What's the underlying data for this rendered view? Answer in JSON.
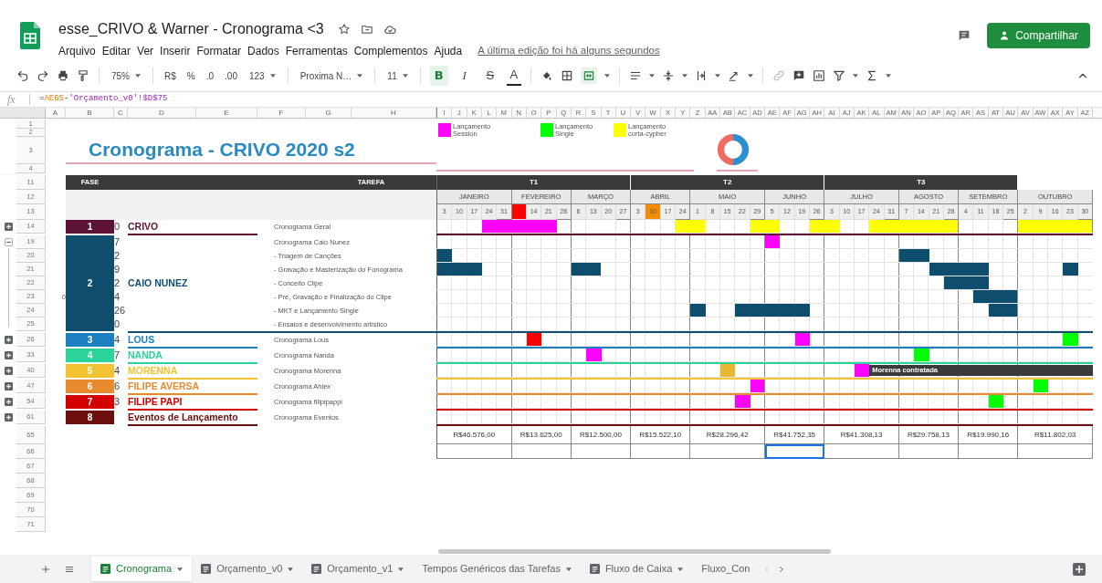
{
  "header": {
    "title": "esse_CRIVO & Warner - Cronograma <3",
    "menus": [
      "Arquivo",
      "Editar",
      "Ver",
      "Inserir",
      "Formatar",
      "Dados",
      "Ferramentas",
      "Complementos",
      "Ajuda"
    ],
    "last_edit": "A última edição foi há alguns segundos",
    "share_button": "Compartilhar"
  },
  "toolbar": {
    "merge_active": true,
    "items": [
      {
        "kind": "dropdown",
        "text": "75%"
      },
      {
        "kind": "plain",
        "text": "R$"
      },
      {
        "kind": "plain",
        "text": "%"
      },
      {
        "kind": "plain",
        "text": ".0"
      },
      {
        "kind": "plain",
        "text": ".00"
      },
      {
        "kind": "dropdown",
        "text": "123"
      },
      {
        "kind": "dropdown",
        "text": "Proxima N…"
      },
      {
        "kind": "dropdown",
        "text": "11"
      },
      {
        "kind": "bold",
        "text": "B",
        "selected": true
      },
      {
        "kind": "italic",
        "text": "I",
        "selected": false
      },
      {
        "kind": "strike",
        "text": "S",
        "selected": false
      },
      {
        "kind": "color",
        "text": "A"
      }
    ]
  },
  "formula_bar": {
    "label": "fx",
    "parts": [
      {
        "kind": "operator",
        "text": "="
      },
      {
        "kind": "reference",
        "text": "AE65"
      },
      {
        "kind": "operator",
        "text": "-"
      },
      {
        "kind": "sheet_reference",
        "text": "'Orçamento_v0'!$D$75"
      }
    ]
  },
  "columns_left": [
    "A",
    "B",
    "C",
    "D",
    "E",
    "F",
    "G",
    "H"
  ],
  "columns_grid": [
    "I",
    "J",
    "K",
    "L",
    "M",
    "N",
    "O",
    "P",
    "Q",
    "R",
    "S",
    "T",
    "U",
    "V",
    "W",
    "X",
    "Y",
    "Z",
    "AA",
    "AB",
    "AC",
    "AD",
    "AE",
    "AF",
    "AG",
    "AH",
    "AI",
    "AJ",
    "AK",
    "AL",
    "AM",
    "AN",
    "AO",
    "AP",
    "AQ",
    "AR",
    "AS",
    "AT",
    "AU",
    "AV",
    "AW",
    "AX",
    "AY",
    "AZ"
  ],
  "top_rows": [
    "1",
    "2",
    "3",
    "4"
  ],
  "sheet_title": "Cronograma - CRIVO 2020 s2",
  "legend": [
    {
      "label": "Lançamento Session",
      "color": "#ff00ff"
    },
    {
      "label": "Lançamento Single",
      "color": "#00ff00"
    },
    {
      "label": "Lançamento curta-cypher",
      "color": "#ffff00"
    }
  ],
  "header_rows": [
    "11",
    "12",
    "13"
  ],
  "fase_header": "FASE",
  "tarefa_header": "TAREFA",
  "timeline": {
    "quarters": [
      {
        "label": "T1",
        "months": [
          {
            "name": "JANEIRO",
            "weeks": [
              {
                "label": "3"
              },
              {
                "label": "10"
              },
              {
                "label": "17"
              },
              {
                "label": "24"
              },
              {
                "label": "31"
              }
            ]
          },
          {
            "name": "FEVEREIRO",
            "weeks": [
              {
                "color": "#ff0000"
              },
              {
                "label": "14"
              },
              {
                "label": "21"
              },
              {
                "label": "28"
              }
            ]
          },
          {
            "name": "MARÇO",
            "weeks": [
              {
                "label": "6"
              },
              {
                "label": "13"
              },
              {
                "label": "20"
              },
              {
                "label": "27"
              }
            ]
          }
        ]
      },
      {
        "label": "T2",
        "months": [
          {
            "name": "ABRIL",
            "weeks": [
              {
                "label": "3"
              },
              {
                "label": "10",
                "color": "#f28c00"
              },
              {
                "label": "17"
              },
              {
                "label": "24"
              }
            ]
          },
          {
            "name": "MAIO",
            "weeks": [
              {
                "label": "1"
              },
              {
                "label": "8"
              },
              {
                "label": "15"
              },
              {
                "label": "22"
              },
              {
                "label": "29"
              }
            ]
          },
          {
            "name": "JUNHO",
            "weeks": [
              {
                "label": "5"
              },
              {
                "label": "12"
              },
              {
                "label": "19"
              },
              {
                "label": "26"
              }
            ]
          }
        ]
      },
      {
        "label": "T3",
        "months": [
          {
            "name": "JULHO",
            "weeks": [
              {
                "label": "3"
              },
              {
                "label": "10"
              },
              {
                "label": "17"
              },
              {
                "label": "24"
              },
              {
                "label": "31"
              }
            ]
          },
          {
            "name": "AGOSTO",
            "weeks": [
              {
                "label": "7"
              },
              {
                "label": "14"
              },
              {
                "label": "21"
              },
              {
                "label": "28"
              }
            ]
          },
          {
            "name": "SETEMBRO",
            "weeks": [
              {
                "label": "4"
              },
              {
                "label": "11"
              },
              {
                "label": "18"
              },
              {
                "label": "25"
              }
            ]
          }
        ]
      },
      {
        "months": [
          {
            "name": "OUTUBRO",
            "weeks": [
              {
                "label": "2"
              },
              {
                "label": "9"
              },
              {
                "label": "16"
              },
              {
                "label": "23"
              },
              {
                "label": "30"
              }
            ]
          }
        ]
      }
    ]
  },
  "phases": [
    {
      "number": "1",
      "color": "#5c1234",
      "name": "CRIVO",
      "collapsed": true,
      "tasks": [
        {
          "row": "14",
          "count": "0",
          "task": "Cronograma Geral",
          "cells": [
            null,
            null,
            null,
            {
              "color": "#ff00ff"
            },
            {
              "color": "#ff00ff"
            },
            {
              "color": "#ff00ff"
            },
            {
              "color": "#ff00ff"
            },
            {
              "color": "#ff00ff"
            },
            null,
            null,
            null,
            null,
            null,
            null,
            null,
            null,
            {
              "color": "#ffff00"
            },
            {
              "color": "#ffff00"
            },
            null,
            null,
            null,
            {
              "color": "#ffff00"
            },
            {
              "color": "#ffff00"
            },
            null,
            null,
            {
              "color": "#ffff00"
            },
            {
              "color": "#ffff00"
            },
            null,
            null,
            {
              "color": "#ffff00"
            },
            {
              "color": "#ffff00"
            },
            {
              "color": "#ffff00"
            },
            {
              "color": "#ffff00"
            },
            {
              "color": "#ffff00"
            },
            {
              "color": "#ffff00"
            },
            null,
            null,
            null,
            null,
            {
              "color": "#ffff00"
            },
            {
              "color": "#ffff00"
            },
            {
              "color": "#ffff00"
            },
            {
              "color": "#ffff00"
            },
            {
              "color": "#ffff00"
            }
          ]
        }
      ]
    },
    {
      "number": "2",
      "color": "#0e4d6e",
      "name": "CAIO NUNEZ",
      "collapsed": false,
      "tasks": [
        {
          "row": "19",
          "count": "7",
          "task": "Cronograma Caio Nunez",
          "cells": [
            null,
            null,
            null,
            null,
            null,
            null,
            null,
            null,
            null,
            null,
            null,
            null,
            null,
            null,
            null,
            null,
            null,
            null,
            null,
            null,
            null,
            null,
            {
              "color": "#ff00ff"
            }
          ]
        },
        {
          "row": "20",
          "count": "2",
          "task": "- Triagem de Canções",
          "cells": [
            {
              "color": "#0e4d6e"
            },
            null,
            null,
            null,
            null,
            null,
            null,
            null,
            null,
            null,
            null,
            null,
            null,
            null,
            null,
            null,
            null,
            null,
            null,
            null,
            null,
            null,
            null,
            null,
            null,
            null,
            null,
            null,
            null,
            null,
            null,
            {
              "color": "#0e4d6e"
            },
            {
              "color": "#0e4d6e"
            }
          ]
        },
        {
          "row": "21",
          "count": "9",
          "task": "- Gravação e Masterização do Fonograma",
          "cells": [
            {
              "color": "#0e4d6e"
            },
            {
              "color": "#0e4d6e"
            },
            {
              "color": "#0e4d6e"
            },
            null,
            null,
            null,
            null,
            null,
            null,
            {
              "color": "#0e4d6e"
            },
            {
              "color": "#0e4d6e"
            },
            null,
            null,
            null,
            null,
            null,
            null,
            null,
            null,
            null,
            null,
            null,
            null,
            null,
            null,
            null,
            null,
            null,
            null,
            null,
            null,
            null,
            null,
            {
              "color": "#0e4d6e"
            },
            {
              "color": "#0e4d6e"
            },
            {
              "color": "#0e4d6e"
            },
            {
              "color": "#0e4d6e"
            },
            null,
            null,
            null,
            null,
            null,
            {
              "color": "#0e4d6e"
            }
          ]
        },
        {
          "row": "22",
          "count": "2",
          "task": "- Conceito Clipe",
          "cells": [
            null,
            null,
            null,
            null,
            null,
            null,
            null,
            null,
            null,
            null,
            null,
            null,
            null,
            null,
            null,
            null,
            null,
            null,
            null,
            null,
            null,
            null,
            null,
            null,
            null,
            null,
            null,
            null,
            null,
            null,
            null,
            null,
            null,
            null,
            {
              "color": "#0e4d6e"
            },
            {
              "color": "#0e4d6e"
            },
            {
              "color": "#0e4d6e"
            }
          ]
        },
        {
          "row": "23",
          "count": "4",
          "column_a": "0",
          "task": "- Pré, Gravação e Finalização do Clipe",
          "cells": [
            null,
            null,
            null,
            null,
            null,
            null,
            null,
            null,
            null,
            null,
            null,
            null,
            null,
            null,
            null,
            null,
            null,
            null,
            null,
            null,
            null,
            null,
            null,
            null,
            null,
            null,
            null,
            null,
            null,
            null,
            null,
            null,
            null,
            null,
            null,
            null,
            {
              "color": "#0e4d6e"
            },
            {
              "color": "#0e4d6e"
            },
            {
              "color": "#0e4d6e"
            }
          ]
        },
        {
          "row": "24",
          "count": "26",
          "task": "- MKT e Lançamento Single",
          "cells": [
            null,
            null,
            null,
            null,
            null,
            null,
            null,
            null,
            null,
            null,
            null,
            null,
            null,
            null,
            null,
            null,
            null,
            {
              "color": "#0e4d6e"
            },
            null,
            null,
            {
              "color": "#0e4d6e"
            },
            {
              "color": "#0e4d6e"
            },
            {
              "color": "#0e4d6e"
            },
            {
              "color": "#0e4d6e"
            },
            {
              "color": "#0e4d6e"
            },
            null,
            null,
            null,
            null,
            null,
            null,
            null,
            null,
            null,
            null,
            null,
            null,
            {
              "color": "#0e4d6e"
            },
            {
              "color": "#0e4d6e"
            }
          ]
        },
        {
          "row": "25",
          "count": "0",
          "task": "- Ensaios e desenvolvimento artístico"
        }
      ]
    },
    {
      "number": "3",
      "color": "#1b7fc0",
      "name": "LOUS",
      "collapsed": true,
      "tasks": [
        {
          "row": "26",
          "count": "4",
          "task": "Cronograma Lous",
          "cells": [
            null,
            null,
            null,
            null,
            null,
            null,
            {
              "color": "#ff0000"
            },
            null,
            null,
            null,
            null,
            null,
            null,
            null,
            null,
            null,
            null,
            null,
            null,
            null,
            null,
            null,
            null,
            null,
            {
              "color": "#ff00ff"
            },
            null,
            null,
            null,
            null,
            null,
            null,
            null,
            null,
            null,
            null,
            null,
            null,
            null,
            null,
            null,
            null,
            null,
            {
              "color": "#00ff00"
            }
          ]
        }
      ]
    },
    {
      "number": "4",
      "color": "#2bd39a",
      "name": "NANDA",
      "collapsed": true,
      "tasks": [
        {
          "row": "33",
          "count": "7",
          "task": "Cronograma Nanda",
          "cells": [
            null,
            null,
            null,
            null,
            null,
            null,
            null,
            null,
            null,
            null,
            {
              "color": "#ff00ff"
            },
            null,
            null,
            null,
            null,
            null,
            null,
            null,
            null,
            null,
            null,
            null,
            null,
            null,
            null,
            null,
            null,
            null,
            null,
            null,
            null,
            null,
            {
              "color": "#00ff00"
            }
          ]
        }
      ]
    },
    {
      "number": "5",
      "color": "#f2c230",
      "name": "MORENNA",
      "collapsed": true,
      "tasks": [
        {
          "row": "40",
          "count": "4",
          "task": "Cronograma Morenna",
          "note": "Morenna contratada",
          "cells": [
            null,
            null,
            null,
            null,
            null,
            null,
            null,
            null,
            null,
            null,
            null,
            null,
            null,
            null,
            null,
            null,
            null,
            null,
            null,
            {
              "color": "#e8b830"
            },
            null,
            null,
            null,
            null,
            null,
            null,
            null,
            null,
            {
              "color": "#ff00ff"
            }
          ]
        }
      ]
    },
    {
      "number": "6",
      "color": "#e88a2e",
      "name": "FILIPE AVERSA",
      "collapsed": true,
      "tasks": [
        {
          "row": "47",
          "count": "6",
          "task": "Cronograma Ahlex",
          "cells": [
            null,
            null,
            null,
            null,
            null,
            null,
            null,
            null,
            null,
            null,
            null,
            null,
            null,
            null,
            null,
            null,
            null,
            null,
            null,
            null,
            null,
            {
              "color": "#ff00ff"
            },
            null,
            null,
            null,
            null,
            null,
            null,
            null,
            null,
            null,
            null,
            null,
            null,
            null,
            null,
            null,
            null,
            null,
            null,
            {
              "color": "#00ff00"
            }
          ]
        }
      ]
    },
    {
      "number": "7",
      "color": "#d40000",
      "name": "FILIPE PAPI",
      "collapsed": true,
      "tasks": [
        {
          "row": "54",
          "count": "3",
          "task": "Cronograma filipipappi",
          "cells": [
            null,
            null,
            null,
            null,
            null,
            null,
            null,
            null,
            null,
            null,
            null,
            null,
            null,
            null,
            null,
            null,
            null,
            null,
            null,
            null,
            {
              "color": "#ff00ff"
            },
            null,
            null,
            null,
            null,
            null,
            null,
            null,
            null,
            null,
            null,
            null,
            null,
            null,
            null,
            null,
            null,
            {
              "color": "#00ff00"
            }
          ]
        }
      ]
    },
    {
      "number": "8",
      "color": "#6e0f0f",
      "name": "Eventos de Lançamento",
      "collapsed": true,
      "tasks": [
        {
          "row": "61",
          "task": "Cronograma Eventos"
        }
      ]
    }
  ],
  "totals_row": {
    "row": "65",
    "values": [
      "R$46.576,00",
      "R$13.625,00",
      "R$12.500,00",
      "R$15.522,10",
      "R$28.296,42",
      "R$41.752,35",
      "R$41.308,13",
      "R$29.758,13",
      "R$19.990,16",
      "R$11.802,03"
    ]
  },
  "selection_row": {
    "row": "66",
    "cells": [
      {
        "selected": false
      },
      {
        "selected": false
      },
      {
        "selected": false
      },
      {
        "selected": false
      },
      {
        "selected": false
      },
      {
        "selected": true
      },
      {
        "selected": false
      },
      {
        "selected": false
      },
      {
        "selected": false
      },
      {
        "selected": false
      }
    ]
  },
  "empty_rows": [
    "67",
    "68",
    "69",
    "70",
    "71"
  ],
  "sheet_tabs": [
    {
      "label": "Cronograma",
      "kind": "icon",
      "selected": true
    },
    {
      "label": "Orçamento_v0",
      "kind": "icon",
      "selected": false
    },
    {
      "label": "Orçamento_v1",
      "kind": "icon",
      "selected": false
    },
    {
      "label": "Tempos Genéricos das Tarefas",
      "kind": "plain",
      "selected": false
    },
    {
      "label": "Fluxo de Caixa",
      "kind": "icon",
      "selected": false
    },
    {
      "label": "Fluxo_Con",
      "kind": "cut",
      "selected": false
    }
  ]
}
